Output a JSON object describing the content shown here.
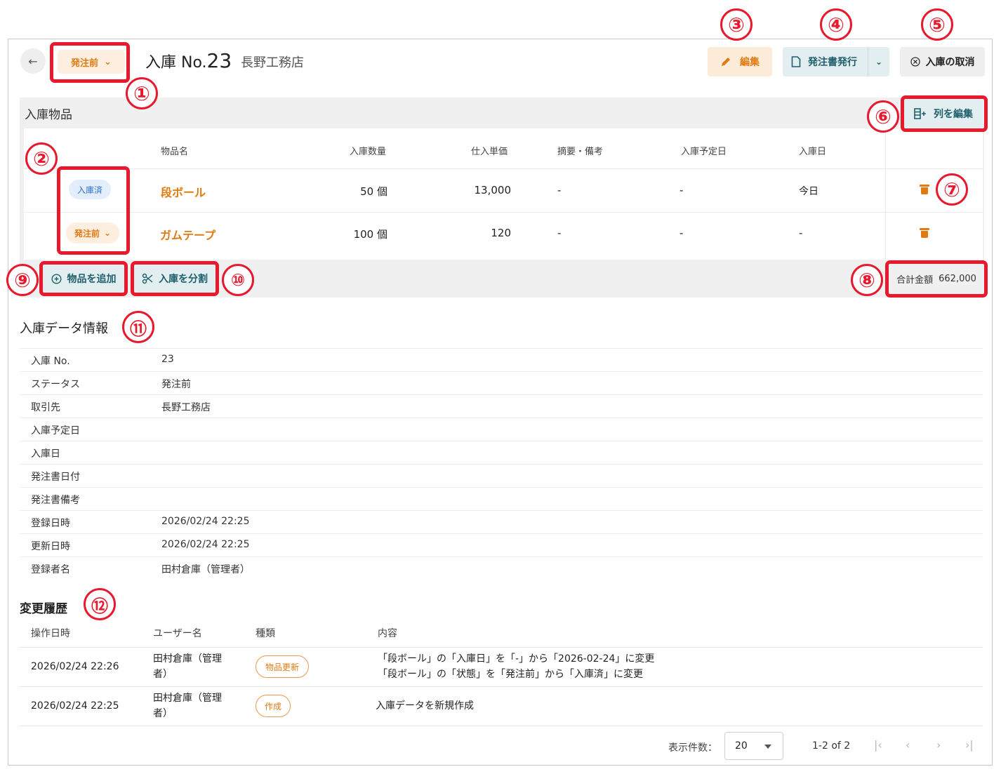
{
  "header": {
    "back_icon": "←",
    "status_label": "発注前",
    "title_prefix": "入庫 No.",
    "title_number": "23",
    "supplier": "長野工務店",
    "edit_label": "編集",
    "po_label": "発注書発行",
    "cancel_label": "入庫の取消"
  },
  "items": {
    "heading": "入庫物品",
    "edit_columns_label": "列を編集",
    "columns": [
      "物品名",
      "入庫数量",
      "仕入単価",
      "摘要・備考",
      "入庫予定日",
      "入庫日"
    ],
    "rows": [
      {
        "status": "入庫済",
        "name": "段ボール",
        "qty": "50 個",
        "price": "13,000",
        "note": "-",
        "planned": "-",
        "received": "今日"
      },
      {
        "status": "発注前",
        "name": "ガムテープ",
        "qty": "100 個",
        "price": "120",
        "note": "-",
        "planned": "-",
        "received": "-"
      }
    ],
    "add_label": "物品を追加",
    "split_label": "入庫を分割",
    "total_label": "合計金額",
    "total_value": "662,000"
  },
  "info": {
    "heading": "入庫データ情報",
    "rows": [
      {
        "key": "入庫 No.",
        "value": "23"
      },
      {
        "key": "ステータス",
        "value": "発注前"
      },
      {
        "key": "取引先",
        "value": "長野工務店"
      },
      {
        "key": "入庫予定日",
        "value": ""
      },
      {
        "key": "入庫日",
        "value": ""
      },
      {
        "key": "発注書日付",
        "value": ""
      },
      {
        "key": "発注書備考",
        "value": ""
      },
      {
        "key": "登録日時",
        "value": "2026/02/24 22:25"
      },
      {
        "key": "更新日時",
        "value": "2026/02/24 22:25"
      },
      {
        "key": "登録者名",
        "value": "田村倉庫（管理者）"
      }
    ]
  },
  "history": {
    "heading": "変更履歴",
    "columns": [
      "操作日時",
      "ユーザー名",
      "種類",
      "内容"
    ],
    "rows": [
      {
        "datetime": "2026/02/24 22:26",
        "user_line1": "田村倉庫（管理",
        "user_line2": "者）",
        "type": "物品更新",
        "content_line1": "「段ボール」の「入庫日」を「-」から「2026-02-24」に変更",
        "content_line2": "「段ボール」の「状態」を「発注前」から「入庫済」に変更"
      },
      {
        "datetime": "2026/02/24 22:25",
        "user_line1": "田村倉庫（管理",
        "user_line2": "者）",
        "type": "作成",
        "content_line1": "入庫データを新規作成",
        "content_line2": ""
      }
    ]
  },
  "pagination": {
    "per_page_label": "表示件数：",
    "per_page_value": "20",
    "range": "1-2 of 2"
  },
  "annotations": [
    "①",
    "②",
    "③",
    "④",
    "⑤",
    "⑥",
    "⑦",
    "⑧",
    "⑨",
    "⑩",
    "⑪",
    "⑫"
  ],
  "colors": {
    "accent_orange": "#e07b12",
    "teal_button_bg": "#e2eef0",
    "teal_text": "#1e5f6b",
    "annotation_red": "#e8192c",
    "badge_blue": "#2f6fd1"
  }
}
